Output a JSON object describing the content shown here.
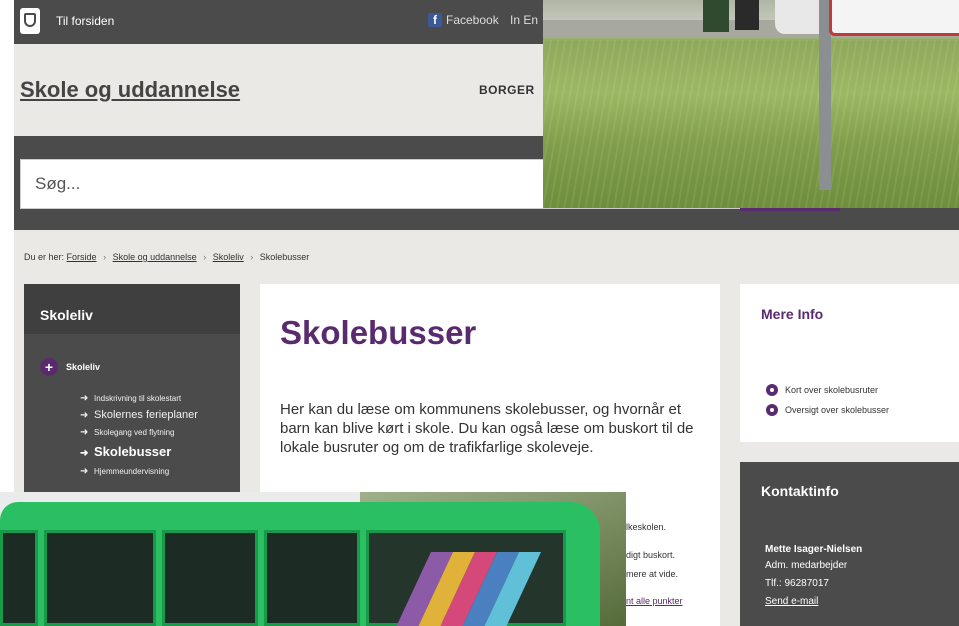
{
  "topbar": {
    "home_label": "Til forsiden",
    "facebook_label": "Facebook",
    "language_label": "In En"
  },
  "header": {
    "site_title": "Skole og uddannelse",
    "nav_borger": "BORGER"
  },
  "search": {
    "placeholder": "Søg..."
  },
  "breadcrumb": {
    "prefix": "Du er her:",
    "items": [
      "Forside",
      "Skole og uddannelse",
      "Skoleliv",
      "Skolebusser"
    ]
  },
  "sidebar": {
    "title": "Skoleliv",
    "section_label": "Skoleliv",
    "items": [
      {
        "label": "Indskrivning til skolestart"
      },
      {
        "label": "Skolernes ferieplaner"
      },
      {
        "label": "Skolegang ved flytning"
      },
      {
        "label": "Skolebusser"
      },
      {
        "label": "Hjemmeundervisning"
      }
    ]
  },
  "main": {
    "heading": "Skolebusser",
    "intro": "Her kan du læse om kommunens skolebusser, og hvornår et barn kan blive kørt i skole. Du kan også læse om buskort til de lokale busruter og om de trafikfarlige skoleveje.",
    "fragments": [
      "lkeskolen.",
      "digt buskort.",
      "mere at vide.",
      "nt alle punkter"
    ]
  },
  "mere_info": {
    "title": "Mere Info",
    "links": [
      "Kort over skolebusruter",
      "Oversigt over skolebusser"
    ]
  },
  "contact": {
    "title": "Kontaktinfo",
    "name": "Mette Isager-Nielsen",
    "role": "Adm. medarbejder",
    "phone": "Tlf.: 96287017",
    "email_link": "Send e-mail"
  },
  "colors": {
    "accent_purple": "#5a2a6e",
    "dark_gray": "#4b4b4b",
    "page_bg": "#ebe9e5"
  }
}
